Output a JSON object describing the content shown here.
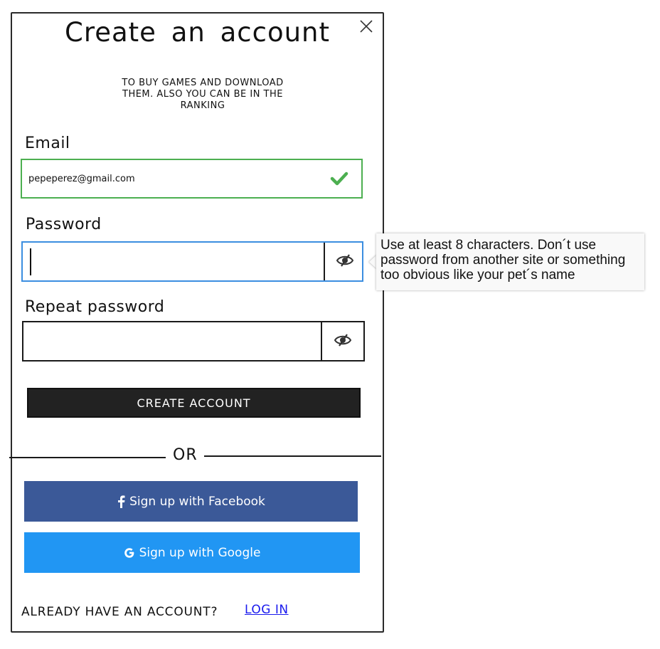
{
  "header": {
    "title": "Create an  account",
    "subtitle": "TO BUY GAMES AND DOWNLOAD THEM. ALSO YOU CAN BE IN THE RANKING",
    "close_icon": "close-icon"
  },
  "form": {
    "email_label": "Email",
    "email_value": "pepeperez@gmail.com",
    "email_status_icon": "checkmark-icon",
    "password_label": "Password",
    "password_value": "",
    "repeat_password_label": "Repeat password",
    "repeat_password_value": "",
    "visibility_icon": "eye-slash-icon",
    "create_button_label": "CREATE ACCOUNT"
  },
  "tooltip": {
    "text": "Use at least 8 characters. Don´t use password from another site or something too obvious like your pet´s name"
  },
  "divider": {
    "label": "OR"
  },
  "social": {
    "facebook_label": "Sign up with Facebook",
    "facebook_icon": "facebook-icon",
    "google_label": "Sign up with Google",
    "google_icon": "google-icon"
  },
  "footer": {
    "prompt": "ALREADY HAVE AN ACCOUNT?",
    "login_label": "LOG IN"
  },
  "colors": {
    "valid_border": "#4caf50",
    "focus_border": "#3c8ee0",
    "facebook": "#3b5998",
    "google": "#2196f3",
    "primary_button": "#222222",
    "link": "#1a1aee"
  }
}
